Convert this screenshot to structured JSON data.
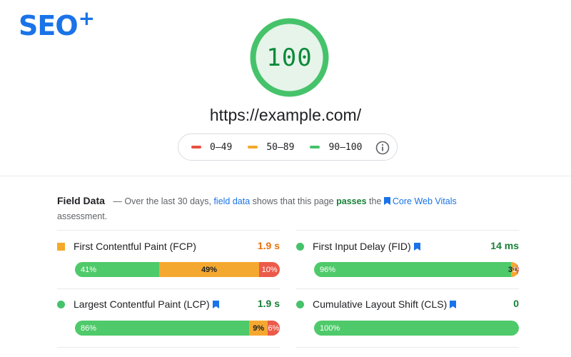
{
  "brand": {
    "logo_text": "SEO",
    "logo_plus": "+"
  },
  "report": {
    "score": "100",
    "url": "https://example.com/"
  },
  "legend": {
    "items": [
      {
        "label": "0–49",
        "color": "#e8503f"
      },
      {
        "label": "50–89",
        "color": "#f4a92a"
      },
      {
        "label": "90–100",
        "color": "#46c36a"
      }
    ],
    "info_icon": "info-icon"
  },
  "field_data": {
    "title": "Field Data",
    "dash": "—",
    "text_1": "Over the last 30 days,",
    "link_field_data": "field data",
    "text_2": "shows that this page",
    "passes": "passes",
    "text_3": "the",
    "link_core_web_vitals": "Core Web Vitals",
    "text_4": "assessment."
  },
  "metrics": [
    {
      "name": "First Contentful Paint (FCP)",
      "value": "1.9 s",
      "marker": "orange-square",
      "bookmark": false,
      "distribution": {
        "good": 41,
        "needs_improvement": 49,
        "poor": 10
      },
      "labels": {
        "good": "41%",
        "needs_improvement": "49%",
        "poor": "10%"
      }
    },
    {
      "name": "First Input Delay (FID)",
      "value": "14 ms",
      "marker": "green-circle",
      "bookmark": true,
      "distribution": {
        "good": 96,
        "needs_improvement": 3,
        "poor": 1
      },
      "labels": {
        "good": "96%",
        "needs_improvement": "3%",
        "poor": "1%"
      }
    },
    {
      "name": "Largest Contentful Paint (LCP)",
      "value": "1.9 s",
      "marker": "green-circle",
      "bookmark": true,
      "distribution": {
        "good": 86,
        "needs_improvement": 9,
        "poor": 6
      },
      "labels": {
        "good": "86%",
        "needs_improvement": "9%",
        "poor": "6%"
      }
    },
    {
      "name": "Cumulative Layout Shift (CLS)",
      "value": "0",
      "marker": "green-circle",
      "bookmark": true,
      "distribution": {
        "good": 100,
        "needs_improvement": 0,
        "poor": 0
      },
      "labels": {
        "good": "100%",
        "needs_improvement": "",
        "poor": ""
      }
    }
  ]
}
